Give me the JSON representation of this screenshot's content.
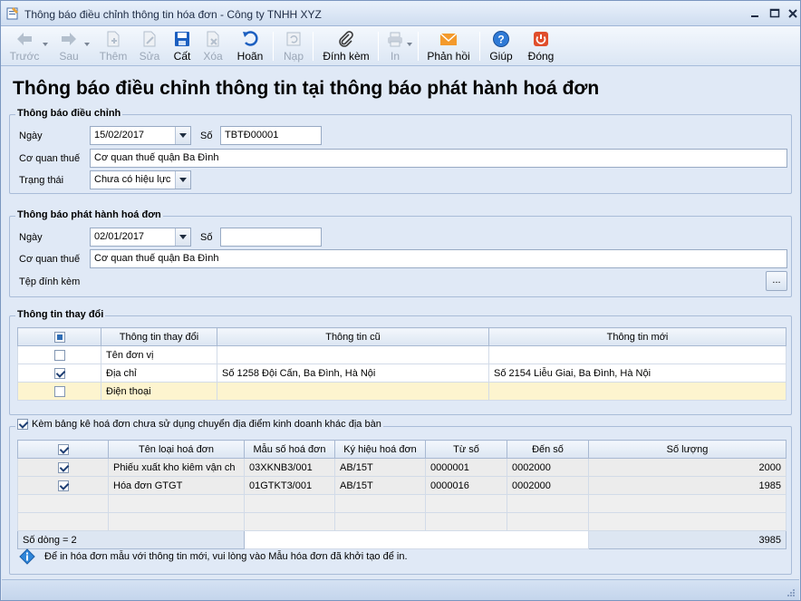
{
  "window": {
    "title": "Thông báo điều chỉnh thông tin hóa đơn - Công ty TNHH XYZ"
  },
  "toolbar": {
    "items": [
      {
        "label": "Trước",
        "icon": "arrow-left-icon",
        "enabled": false
      },
      {
        "label": "Sau",
        "icon": "arrow-right-icon",
        "enabled": false
      },
      {
        "label": "Thêm",
        "icon": "add-doc-icon",
        "enabled": false
      },
      {
        "label": "Sửa",
        "icon": "edit-icon",
        "enabled": false
      },
      {
        "label": "Cất",
        "icon": "save-icon",
        "enabled": true
      },
      {
        "label": "Xóa",
        "icon": "delete-icon",
        "enabled": false
      },
      {
        "label": "Hoãn",
        "icon": "undo-icon",
        "enabled": true
      },
      {
        "label": "Nạp",
        "icon": "reload-icon",
        "enabled": false
      },
      {
        "label": "Đính kèm",
        "icon": "paperclip-icon",
        "enabled": true
      },
      {
        "label": "In",
        "icon": "print-icon",
        "enabled": false
      },
      {
        "label": "Phản hồi",
        "icon": "mail-icon",
        "enabled": true
      },
      {
        "label": "Giúp",
        "icon": "help-icon",
        "enabled": true
      },
      {
        "label": "Đóng",
        "icon": "close-icon",
        "enabled": true
      }
    ]
  },
  "page_title": "Thông báo điều chỉnh thông tin tại thông báo phát hành hoá đơn",
  "adjust_notice": {
    "title": "Thông báo điều chỉnh",
    "date_label": "Ngày",
    "date_value": "15/02/2017",
    "number_label": "Số",
    "number_value": "TBTĐ00001",
    "tax_office_label": "Cơ quan thuế",
    "tax_office_value": "Cơ quan thuế quận Ba Đình",
    "status_label": "Trạng thái",
    "status_value": "Chưa có hiệu lực"
  },
  "issue_notice": {
    "title": "Thông báo phát hành hoá đơn",
    "date_label": "Ngày",
    "date_value": "02/01/2017",
    "number_label": "Số",
    "number_value": "",
    "tax_office_label": "Cơ quan thuế",
    "tax_office_value": "Cơ quan thuế quận Ba Đình",
    "attachment_label": "Tệp đính kèm",
    "browse_label": "..."
  },
  "changes": {
    "title": "Thông tin thay đổi",
    "columns": [
      "Thông tin thay đổi",
      "Thông tin cũ",
      "Thông tin mới"
    ],
    "rows": [
      {
        "checked": false,
        "field": "Tên đơn vị",
        "old": "",
        "new": ""
      },
      {
        "checked": true,
        "field": "Địa chỉ",
        "old": "Số 1258 Đội Cấn, Ba Đình, Hà Nội",
        "new": "Số 2154 Liễu Giai, Ba Đình, Hà Nội"
      },
      {
        "checked": false,
        "field": "Điện thoại",
        "old": "",
        "new": ""
      }
    ]
  },
  "unused_invoices": {
    "checked": true,
    "title": "Kèm bảng kê hoá đơn chưa sử dụng chuyển địa điểm kinh doanh khác địa bàn",
    "columns": [
      "Tên loại hoá đơn",
      "Mẫu số hoá đơn",
      "Ký hiệu hoá đơn",
      "Từ số",
      "Đến số",
      "Số lượng"
    ],
    "rows": [
      {
        "checked": true,
        "name": "Phiếu xuất kho kiêm vận ch",
        "template": "03XKNB3/001",
        "symbol": "AB/15T",
        "from": "0000001",
        "to": "0002000",
        "qty": "2000"
      },
      {
        "checked": true,
        "name": "Hóa đơn GTGT",
        "template": "01GTKT3/001",
        "symbol": "AB/15T",
        "from": "0000016",
        "to": "0002000",
        "qty": "1985"
      }
    ],
    "footer_count": "Số dòng = 2",
    "footer_total": "3985"
  },
  "info_text": "Để in hóa đơn mẫu với thông tin mới, vui lòng vào Mẫu hóa đơn đã khởi tạo để in."
}
